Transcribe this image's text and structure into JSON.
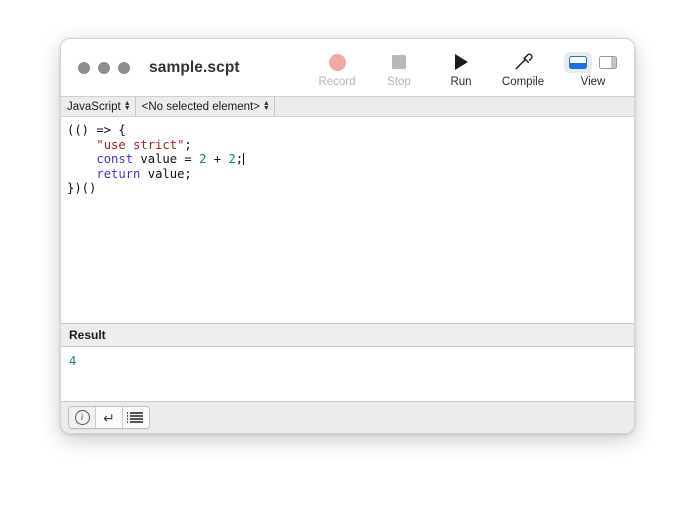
{
  "window": {
    "title": "sample.scpt",
    "traffic_lights": [
      "close",
      "minimize",
      "zoom"
    ]
  },
  "toolbar": {
    "items": [
      {
        "label": "Record",
        "icon": "record-circle-icon",
        "enabled": false
      },
      {
        "label": "Stop",
        "icon": "stop-square-icon",
        "enabled": false
      },
      {
        "label": "Run",
        "icon": "run-triangle-icon",
        "enabled": true
      },
      {
        "label": "Compile",
        "icon": "hammer-icon",
        "enabled": true
      }
    ],
    "view": {
      "label": "View",
      "buttons": [
        {
          "icon": "bottom-panel-icon",
          "active": true,
          "color": "#1a6ef0"
        },
        {
          "icon": "right-panel-icon",
          "active": false,
          "color": "#c3c3c3"
        }
      ]
    }
  },
  "selector_bar": {
    "language": "JavaScript",
    "element": "<No selected element>"
  },
  "editor": {
    "lines": [
      {
        "tokens": [
          {
            "t": "(() => {",
            "c": "pl"
          }
        ]
      },
      {
        "tokens": [
          {
            "t": "    ",
            "c": "pl"
          },
          {
            "t": "\"use strict\"",
            "c": "str"
          },
          {
            "t": ";",
            "c": "pl"
          }
        ]
      },
      {
        "tokens": [
          {
            "t": "",
            "c": "pl"
          }
        ]
      },
      {
        "tokens": [
          {
            "t": "    ",
            "c": "pl"
          },
          {
            "t": "const",
            "c": "kw"
          },
          {
            "t": " value = ",
            "c": "pl"
          },
          {
            "t": "2",
            "c": "num"
          },
          {
            "t": " + ",
            "c": "pl"
          },
          {
            "t": "2",
            "c": "num"
          },
          {
            "t": ";",
            "c": "pl"
          }
        ],
        "caret": true
      },
      {
        "tokens": [
          {
            "t": "",
            "c": "pl"
          }
        ]
      },
      {
        "tokens": [
          {
            "t": "    ",
            "c": "pl"
          },
          {
            "t": "return",
            "c": "kw"
          },
          {
            "t": " value;",
            "c": "pl"
          }
        ]
      },
      {
        "tokens": [
          {
            "t": "})()",
            "c": "pl"
          }
        ]
      }
    ]
  },
  "result": {
    "header": "Result",
    "value": "4"
  },
  "bottom_bar": {
    "segments": [
      {
        "icon": "info-circle-icon",
        "selected": true
      },
      {
        "icon": "return-arrow-icon",
        "selected": false
      },
      {
        "icon": "list-icon",
        "selected": false
      }
    ],
    "return_glyph": "↵"
  }
}
